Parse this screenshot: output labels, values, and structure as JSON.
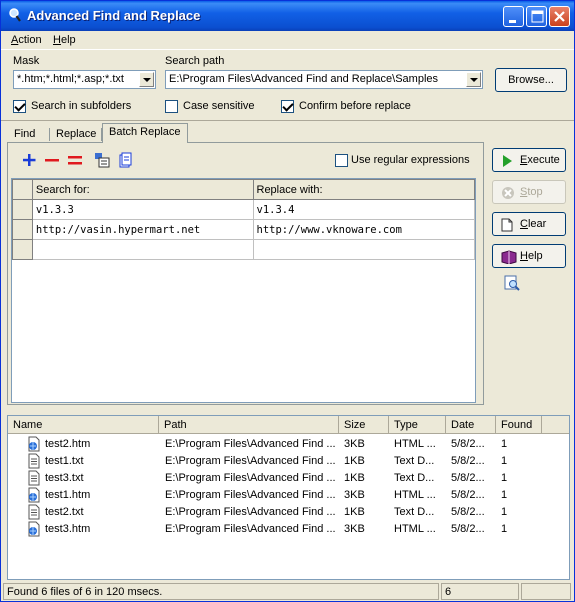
{
  "window": {
    "title": "Advanced Find and Replace"
  },
  "menu": {
    "action": "Action",
    "help": "Help"
  },
  "mask": {
    "label": "Mask",
    "value": "*.htm;*.html;*.asp;*.txt"
  },
  "search_path": {
    "label": "Search path",
    "value": "E:\\Program Files\\Advanced Find and Replace\\Samples"
  },
  "browse_label": "Browse...",
  "options": {
    "subfolders": {
      "label": "Search in subfolders",
      "checked": true
    },
    "case": {
      "label": "Case sensitive",
      "checked": false
    },
    "confirm": {
      "label": "Confirm before replace",
      "checked": true
    }
  },
  "tabs": [
    {
      "label": "Find"
    },
    {
      "label": "Replace"
    },
    {
      "label": "Batch Replace",
      "active": true
    }
  ],
  "toolbar": {
    "icons": [
      "add-row-icon",
      "delete-row-icon",
      "delete-all-icon",
      "load-list-icon",
      "save-list-icon"
    ],
    "regex": {
      "label": "Use regular expressions",
      "checked": false
    }
  },
  "grid": {
    "headers": [
      "Search for:",
      "Replace with:"
    ],
    "rows": [
      [
        "v1.3.3",
        "v1.3.4"
      ],
      [
        "http://vasin.hypermart.net",
        "http://www.vknoware.com"
      ],
      [
        "",
        ""
      ]
    ]
  },
  "actions": {
    "execute": "Execute",
    "stop": "Stop",
    "clear": "Clear",
    "help": "Help"
  },
  "results": {
    "columns": [
      "Name",
      "Path",
      "Size",
      "Type",
      "Date",
      "Found"
    ],
    "rows": [
      {
        "icon": "html-file-icon",
        "name": "test2.htm",
        "path": "E:\\Program Files\\Advanced Find ...",
        "size": "3KB",
        "type": "HTML ...",
        "date": "5/8/2...",
        "found": "1"
      },
      {
        "icon": "text-file-icon",
        "name": "test1.txt",
        "path": "E:\\Program Files\\Advanced Find ...",
        "size": "1KB",
        "type": "Text D...",
        "date": "5/8/2...",
        "found": "1"
      },
      {
        "icon": "text-file-icon",
        "name": "test3.txt",
        "path": "E:\\Program Files\\Advanced Find ...",
        "size": "1KB",
        "type": "Text D...",
        "date": "5/8/2...",
        "found": "1"
      },
      {
        "icon": "html-file-icon",
        "name": "test1.htm",
        "path": "E:\\Program Files\\Advanced Find ...",
        "size": "3KB",
        "type": "HTML ...",
        "date": "5/8/2...",
        "found": "1"
      },
      {
        "icon": "text-file-icon",
        "name": "test2.txt",
        "path": "E:\\Program Files\\Advanced Find ...",
        "size": "1KB",
        "type": "Text D...",
        "date": "5/8/2...",
        "found": "1"
      },
      {
        "icon": "html-file-icon",
        "name": "test3.htm",
        "path": "E:\\Program Files\\Advanced Find ...",
        "size": "3KB",
        "type": "HTML ...",
        "date": "5/8/2...",
        "found": "1"
      }
    ]
  },
  "status": {
    "message": "Found 6 files of 6 in 120 msecs.",
    "count": "6"
  }
}
